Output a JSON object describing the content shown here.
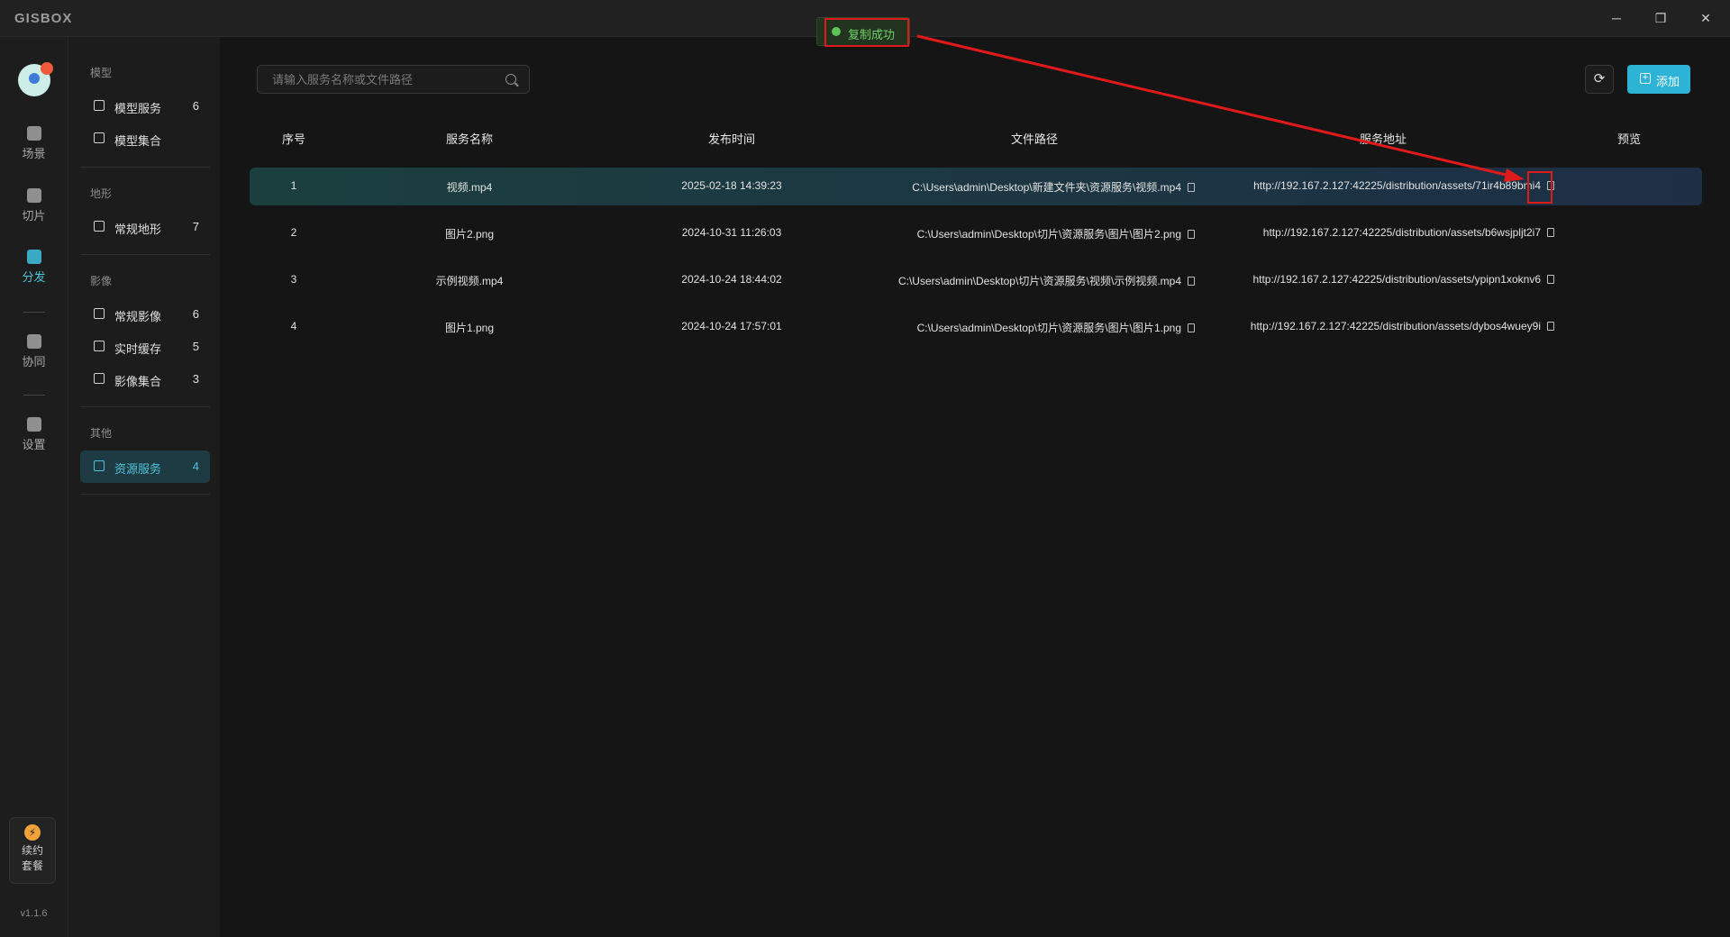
{
  "app": {
    "logo": "GISBOX"
  },
  "window_controls": {
    "minimize": "─",
    "maximize": "❐",
    "close": "✕"
  },
  "rail": {
    "items": [
      {
        "label": "场景",
        "icon": "scene-icon"
      },
      {
        "label": "切片",
        "icon": "tile-icon"
      },
      {
        "label": "分发",
        "icon": "distribute-icon",
        "active": true
      },
      {
        "label": "协同",
        "icon": "collab-icon"
      },
      {
        "label": "设置",
        "icon": "settings-icon"
      }
    ],
    "renew": {
      "line1": "续约",
      "line2": "套餐",
      "icon": "bolt-icon"
    },
    "version": "v1.1.6"
  },
  "sidebar": {
    "groups": [
      {
        "title": "模型",
        "items": [
          {
            "label": "模型服务",
            "count": "6"
          },
          {
            "label": "模型集合",
            "count": ""
          }
        ]
      },
      {
        "title": "地形",
        "items": [
          {
            "label": "常规地形",
            "count": "7"
          }
        ]
      },
      {
        "title": "影像",
        "items": [
          {
            "label": "常规影像",
            "count": "6"
          },
          {
            "label": "实时缓存",
            "count": "5"
          },
          {
            "label": "影像集合",
            "count": "3"
          }
        ]
      },
      {
        "title": "其他",
        "items": [
          {
            "label": "资源服务",
            "count": "4",
            "active": true
          }
        ]
      }
    ]
  },
  "search": {
    "placeholder": "请输入服务名称或文件路径"
  },
  "toolbar": {
    "refresh_icon": "⟳",
    "add_label": "添加"
  },
  "table": {
    "headers": [
      "序号",
      "服务名称",
      "发布时间",
      "文件路径",
      "服务地址",
      "预览"
    ],
    "rows": [
      {
        "no": "1",
        "name": "视频.mp4",
        "time": "2025-02-18 14:39:23",
        "path": "C:\\Users\\admin\\Desktop\\新建文件夹\\资源服务\\视频.mp4",
        "url": "http://192.167.2.127:42225/distribution/assets/71ir4b89bmi4"
      },
      {
        "no": "2",
        "name": "图片2.png",
        "time": "2024-10-31 11:26:03",
        "path": "C:\\Users\\admin\\Desktop\\切片\\资源服务\\图片\\图片2.png",
        "url": "http://192.167.2.127:42225/distribution/assets/b6wsjpljt2i7"
      },
      {
        "no": "3",
        "name": "示例视频.mp4",
        "time": "2024-10-24 18:44:02",
        "path": "C:\\Users\\admin\\Desktop\\切片\\资源服务\\视频\\示例视频.mp4",
        "url": "http://192.167.2.127:42225/distribution/assets/ypipn1xoknv6"
      },
      {
        "no": "4",
        "name": "图片1.png",
        "time": "2024-10-24 17:57:01",
        "path": "C:\\Users\\admin\\Desktop\\切片\\资源服务\\图片\\图片1.png",
        "url": "http://192.167.2.127:42225/distribution/assets/dybos4wuey9i"
      }
    ]
  },
  "toast": {
    "text": "复制成功"
  },
  "colors": {
    "accent": "#2db3d6",
    "success": "#5ec45a",
    "annotation": "#e01a1a"
  }
}
